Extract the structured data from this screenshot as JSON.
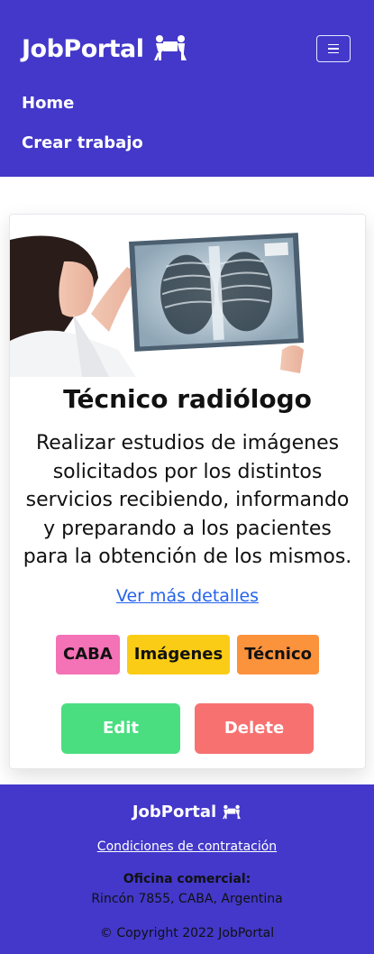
{
  "header": {
    "brand": "JobPortal",
    "nav": [
      {
        "label": "Home"
      },
      {
        "label": "Crear trabajo"
      }
    ]
  },
  "card": {
    "title": "Técnico radiólogo",
    "description": "Realizar estudios de imágenes solicitados por los distintos servicios recibiendo, informando y preparando a los pacientes para la obtención de los mismos.",
    "link": "Ver más detalles",
    "tags": [
      "CABA",
      "Imágenes",
      "Técnico"
    ],
    "edit_label": "Edit",
    "delete_label": "Delete"
  },
  "footer": {
    "brand": "JobPortal",
    "link": "Condiciones de contratación",
    "office_label": "Oficina comercial:",
    "address": "Rincón 7855, CABA, Argentina",
    "copyright": "© Copyright 2022 JobPortal"
  },
  "colors": {
    "primary": "#4338ca",
    "tag_caba": "#f472b6",
    "tag_imagenes": "#facc15",
    "tag_tecnico": "#fb923c",
    "edit": "#4ade80",
    "delete": "#f87171"
  }
}
